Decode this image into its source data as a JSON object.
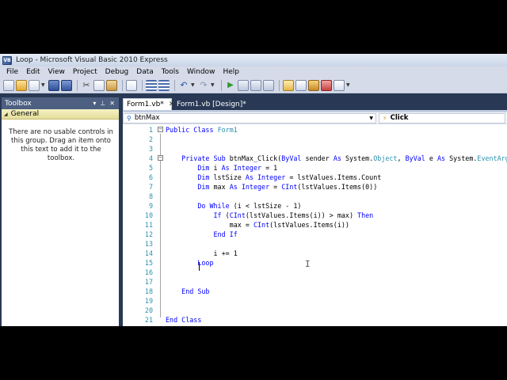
{
  "window": {
    "title": "Loop - Microsoft Visual Basic 2010 Express",
    "icon": "vb-icon"
  },
  "menu": [
    "File",
    "Edit",
    "View",
    "Project",
    "Debug",
    "Data",
    "Tools",
    "Window",
    "Help"
  ],
  "toolbar": {
    "icons": [
      "new-project-icon",
      "open-icon",
      "add-item-icon",
      "save-icon",
      "save-all-icon",
      "cut-icon",
      "copy-icon",
      "paste-icon",
      "find-icon",
      "comment-icon",
      "uncomment-icon",
      "undo-icon",
      "redo-icon",
      "start-debug-icon",
      "step-into-icon",
      "step-over-icon",
      "step-out-icon",
      "solution-explorer-icon",
      "properties-icon",
      "object-browser-icon",
      "toolbox-icon",
      "error-list-icon"
    ]
  },
  "toolbox": {
    "title": "Toolbox",
    "pin_glyph": "▾ ⊥ ✕",
    "group": "General",
    "empty_message": "There are no usable controls in this group. Drag an item onto this text to add it to the toolbox."
  },
  "tabs": [
    {
      "label": "Form1.vb*",
      "active": true
    },
    {
      "label": "Form1.vb [Design]*",
      "active": false
    }
  ],
  "navbar": {
    "object": "btnMax",
    "event": "Click"
  },
  "code": {
    "lines": [
      {
        "n": "1",
        "tokens": [
          {
            "t": "Public Class ",
            "c": "kw"
          },
          {
            "t": "Form1",
            "c": "ty"
          }
        ]
      },
      {
        "n": "2",
        "tokens": []
      },
      {
        "n": "3",
        "tokens": []
      },
      {
        "n": "4",
        "tokens": [
          {
            "t": "    Private Sub ",
            "c": "kw"
          },
          {
            "t": "btnMax_Click(",
            "c": ""
          },
          {
            "t": "ByVal",
            "c": "kw"
          },
          {
            "t": " sender ",
            "c": ""
          },
          {
            "t": "As",
            "c": "kw"
          },
          {
            "t": " System.",
            "c": ""
          },
          {
            "t": "Object",
            "c": "ty"
          },
          {
            "t": ", ",
            "c": ""
          },
          {
            "t": "ByVal",
            "c": "kw"
          },
          {
            "t": " e ",
            "c": ""
          },
          {
            "t": "As",
            "c": "kw"
          },
          {
            "t": " System.",
            "c": ""
          },
          {
            "t": "EventArgs",
            "c": "ty"
          }
        ]
      },
      {
        "n": "5",
        "tokens": [
          {
            "t": "        Dim",
            "c": "kw"
          },
          {
            "t": " i ",
            "c": ""
          },
          {
            "t": "As Integer",
            "c": "kw"
          },
          {
            "t": " = 1",
            "c": ""
          }
        ]
      },
      {
        "n": "6",
        "tokens": [
          {
            "t": "        Dim",
            "c": "kw"
          },
          {
            "t": " lstSize ",
            "c": ""
          },
          {
            "t": "As Integer",
            "c": "kw"
          },
          {
            "t": " = lstValues.Items.Count",
            "c": ""
          }
        ]
      },
      {
        "n": "7",
        "tokens": [
          {
            "t": "        Dim",
            "c": "kw"
          },
          {
            "t": " max ",
            "c": ""
          },
          {
            "t": "As Integer",
            "c": "kw"
          },
          {
            "t": " = ",
            "c": ""
          },
          {
            "t": "CInt",
            "c": "kw"
          },
          {
            "t": "(lstValues.Items(0))",
            "c": ""
          }
        ]
      },
      {
        "n": "8",
        "tokens": []
      },
      {
        "n": "9",
        "tokens": [
          {
            "t": "        Do While",
            "c": "kw"
          },
          {
            "t": " (i < lstSize - 1)",
            "c": ""
          }
        ]
      },
      {
        "n": "10",
        "tokens": [
          {
            "t": "            If",
            "c": "kw"
          },
          {
            "t": " (",
            "c": ""
          },
          {
            "t": "CInt",
            "c": "kw"
          },
          {
            "t": "(lstValues.Items(i)) > max) ",
            "c": ""
          },
          {
            "t": "Then",
            "c": "kw"
          }
        ]
      },
      {
        "n": "11",
        "tokens": [
          {
            "t": "                max = ",
            "c": ""
          },
          {
            "t": "CInt",
            "c": "kw"
          },
          {
            "t": "(lstValues.Items(i))",
            "c": ""
          }
        ]
      },
      {
        "n": "12",
        "tokens": [
          {
            "t": "            End If",
            "c": "kw"
          }
        ]
      },
      {
        "n": "13",
        "tokens": []
      },
      {
        "n": "14",
        "tokens": [
          {
            "t": "            i += 1",
            "c": ""
          }
        ]
      },
      {
        "n": "15",
        "tokens": [
          {
            "t": "        Loop",
            "c": "kw"
          }
        ]
      },
      {
        "n": "16",
        "tokens": []
      },
      {
        "n": "17",
        "tokens": []
      },
      {
        "n": "18",
        "tokens": [
          {
            "t": "    End Sub",
            "c": "kw"
          }
        ]
      },
      {
        "n": "19",
        "tokens": []
      },
      {
        "n": "20",
        "tokens": []
      },
      {
        "n": "21",
        "tokens": [
          {
            "t": "End Class",
            "c": "kw"
          }
        ]
      }
    ]
  },
  "colors": {
    "keyword": "#0000ff",
    "type": "#2b91af",
    "line_number": "#2b91af",
    "ide_frame": "#293955"
  }
}
